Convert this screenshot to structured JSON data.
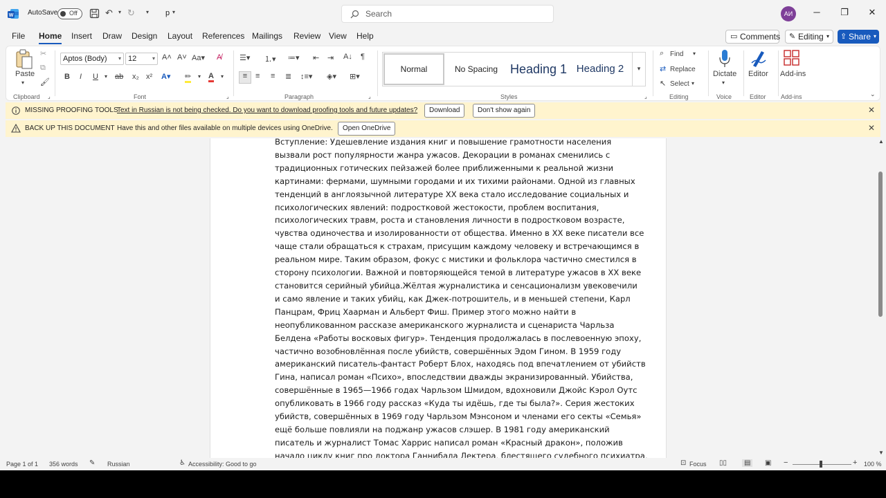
{
  "titlebar": {
    "autosave_label": "AutoSave",
    "autosave_state": "Off",
    "doc_name": "p",
    "search_placeholder": "Search",
    "avatar_initials": "АИ",
    "minimize": "─",
    "restore": "❐",
    "close": "✕"
  },
  "tabs": [
    "File",
    "Home",
    "Insert",
    "Draw",
    "Design",
    "Layout",
    "References",
    "Mailings",
    "Review",
    "View",
    "Help"
  ],
  "header_buttons": {
    "comments": "Comments",
    "editing": "Editing",
    "share": "Share"
  },
  "ribbon": {
    "paste": "Paste",
    "clipboard": "Clipboard",
    "font_name": "Aptos (Body)",
    "font_size": "12",
    "font": "Font",
    "paragraph": "Paragraph",
    "styles_label": "Styles",
    "styles": [
      "Normal",
      "No Spacing",
      "Heading 1",
      "Heading 2"
    ],
    "find": "Find",
    "replace": "Replace",
    "select": "Select",
    "editing": "Editing",
    "dictate": "Dictate",
    "voice": "Voice",
    "editor": "Editor",
    "editor_group": "Editor",
    "addins": "Add-ins",
    "addins_group": "Add-ins"
  },
  "messages": {
    "proofing_title": "MISSING PROOFING TOOLS",
    "proofing_text": "Text in Russian is not being checked. Do you want to download proofing tools and future updates?",
    "download": "Download",
    "dont_show": "Don't show again",
    "backup_title": "BACK UP THIS DOCUMENT",
    "backup_text": "Have this and other files available on multiple devices using OneDrive.",
    "open_onedrive": "Open OneDrive"
  },
  "document": {
    "lines": [
      "Вступление: Удешевление издания книг и повышение грамотности населения",
      "вызвали рост популярности жанра ужасов. Декорации в романах сменились с",
      "традиционных готических пейзажей более приближенными к реальной жизни",
      "картинами: фермами, шумными городами и их тихими районами. Одной из главных",
      "тенденций в англоязычной литературе XX века стало исследование социальных и",
      "психологических явлений: подростковой жестокости, проблем воспитания,",
      "психологических травм, роста и становления личности в подростковом возрасте,",
      "чувства одиночества и изолированности от общества. Именно в XX веке писатели все",
      "чаще стали обращаться к страхам, присущим каждому человеку и встречающимся в",
      "реальном мире. Таким образом, фокус с мистики и фольклора частично сместился в",
      "сторону психологии. Важной и повторяющейся темой в литературе ужасов в XX веке",
      "становится серийный убийца.Жёлтая журналистика и сенсационализм увековечили",
      "и само явление и таких убийц, как Джек-потрошитель, и в меньшей степени, Карл",
      "Панцрам, Фриц Хаарман и Альберт Фиш. Пример этого можно найти в",
      "неопубликованном рассказе американского  журналиста и сценариста Чарльза",
      "Белдена «Работы восковых фигур». Тенденция продолжалась в послевоенную эпоху,",
      "частично возобновлённая после убийств, совершённых Эдом Гином. В 1959 году",
      "американский писатель-фантаст Роберт Блох, находясь под впечатлением от убийств",
      "Гина, написал роман «Психо», впоследствии дважды экранизированный. Убийства,",
      "совершённые в 1965—1966 годах Чарльзом Шмидом, вдохновили Джойс Кэрол Оутс",
      "опубликовать в 1966 году рассказ «Куда ты идёшь, где ты была?». Серия жестоких",
      "убийств, совершённых в 1969 году Чарльзом Мэнсоном и членами его секты «Семья»",
      "ещё больше повлияли на поджанр ужасов слэшер. В 1981 году американский",
      "писатель и журналист Томас Харрис написал роман «Красный дракон», положив",
      "начало циклу книг про доктора Ганнибала Лектера, блестящего судебного психиатра,"
    ]
  },
  "status": {
    "page": "Page 1 of 1",
    "words": "356 words",
    "language": "Russian",
    "accessibility": "Accessibility: Good to go",
    "focus": "Focus",
    "zoom": "100 %"
  },
  "colors": {
    "accent": "#185abd",
    "message_bar": "#fff4ce",
    "avatar": "#7e3f98"
  }
}
